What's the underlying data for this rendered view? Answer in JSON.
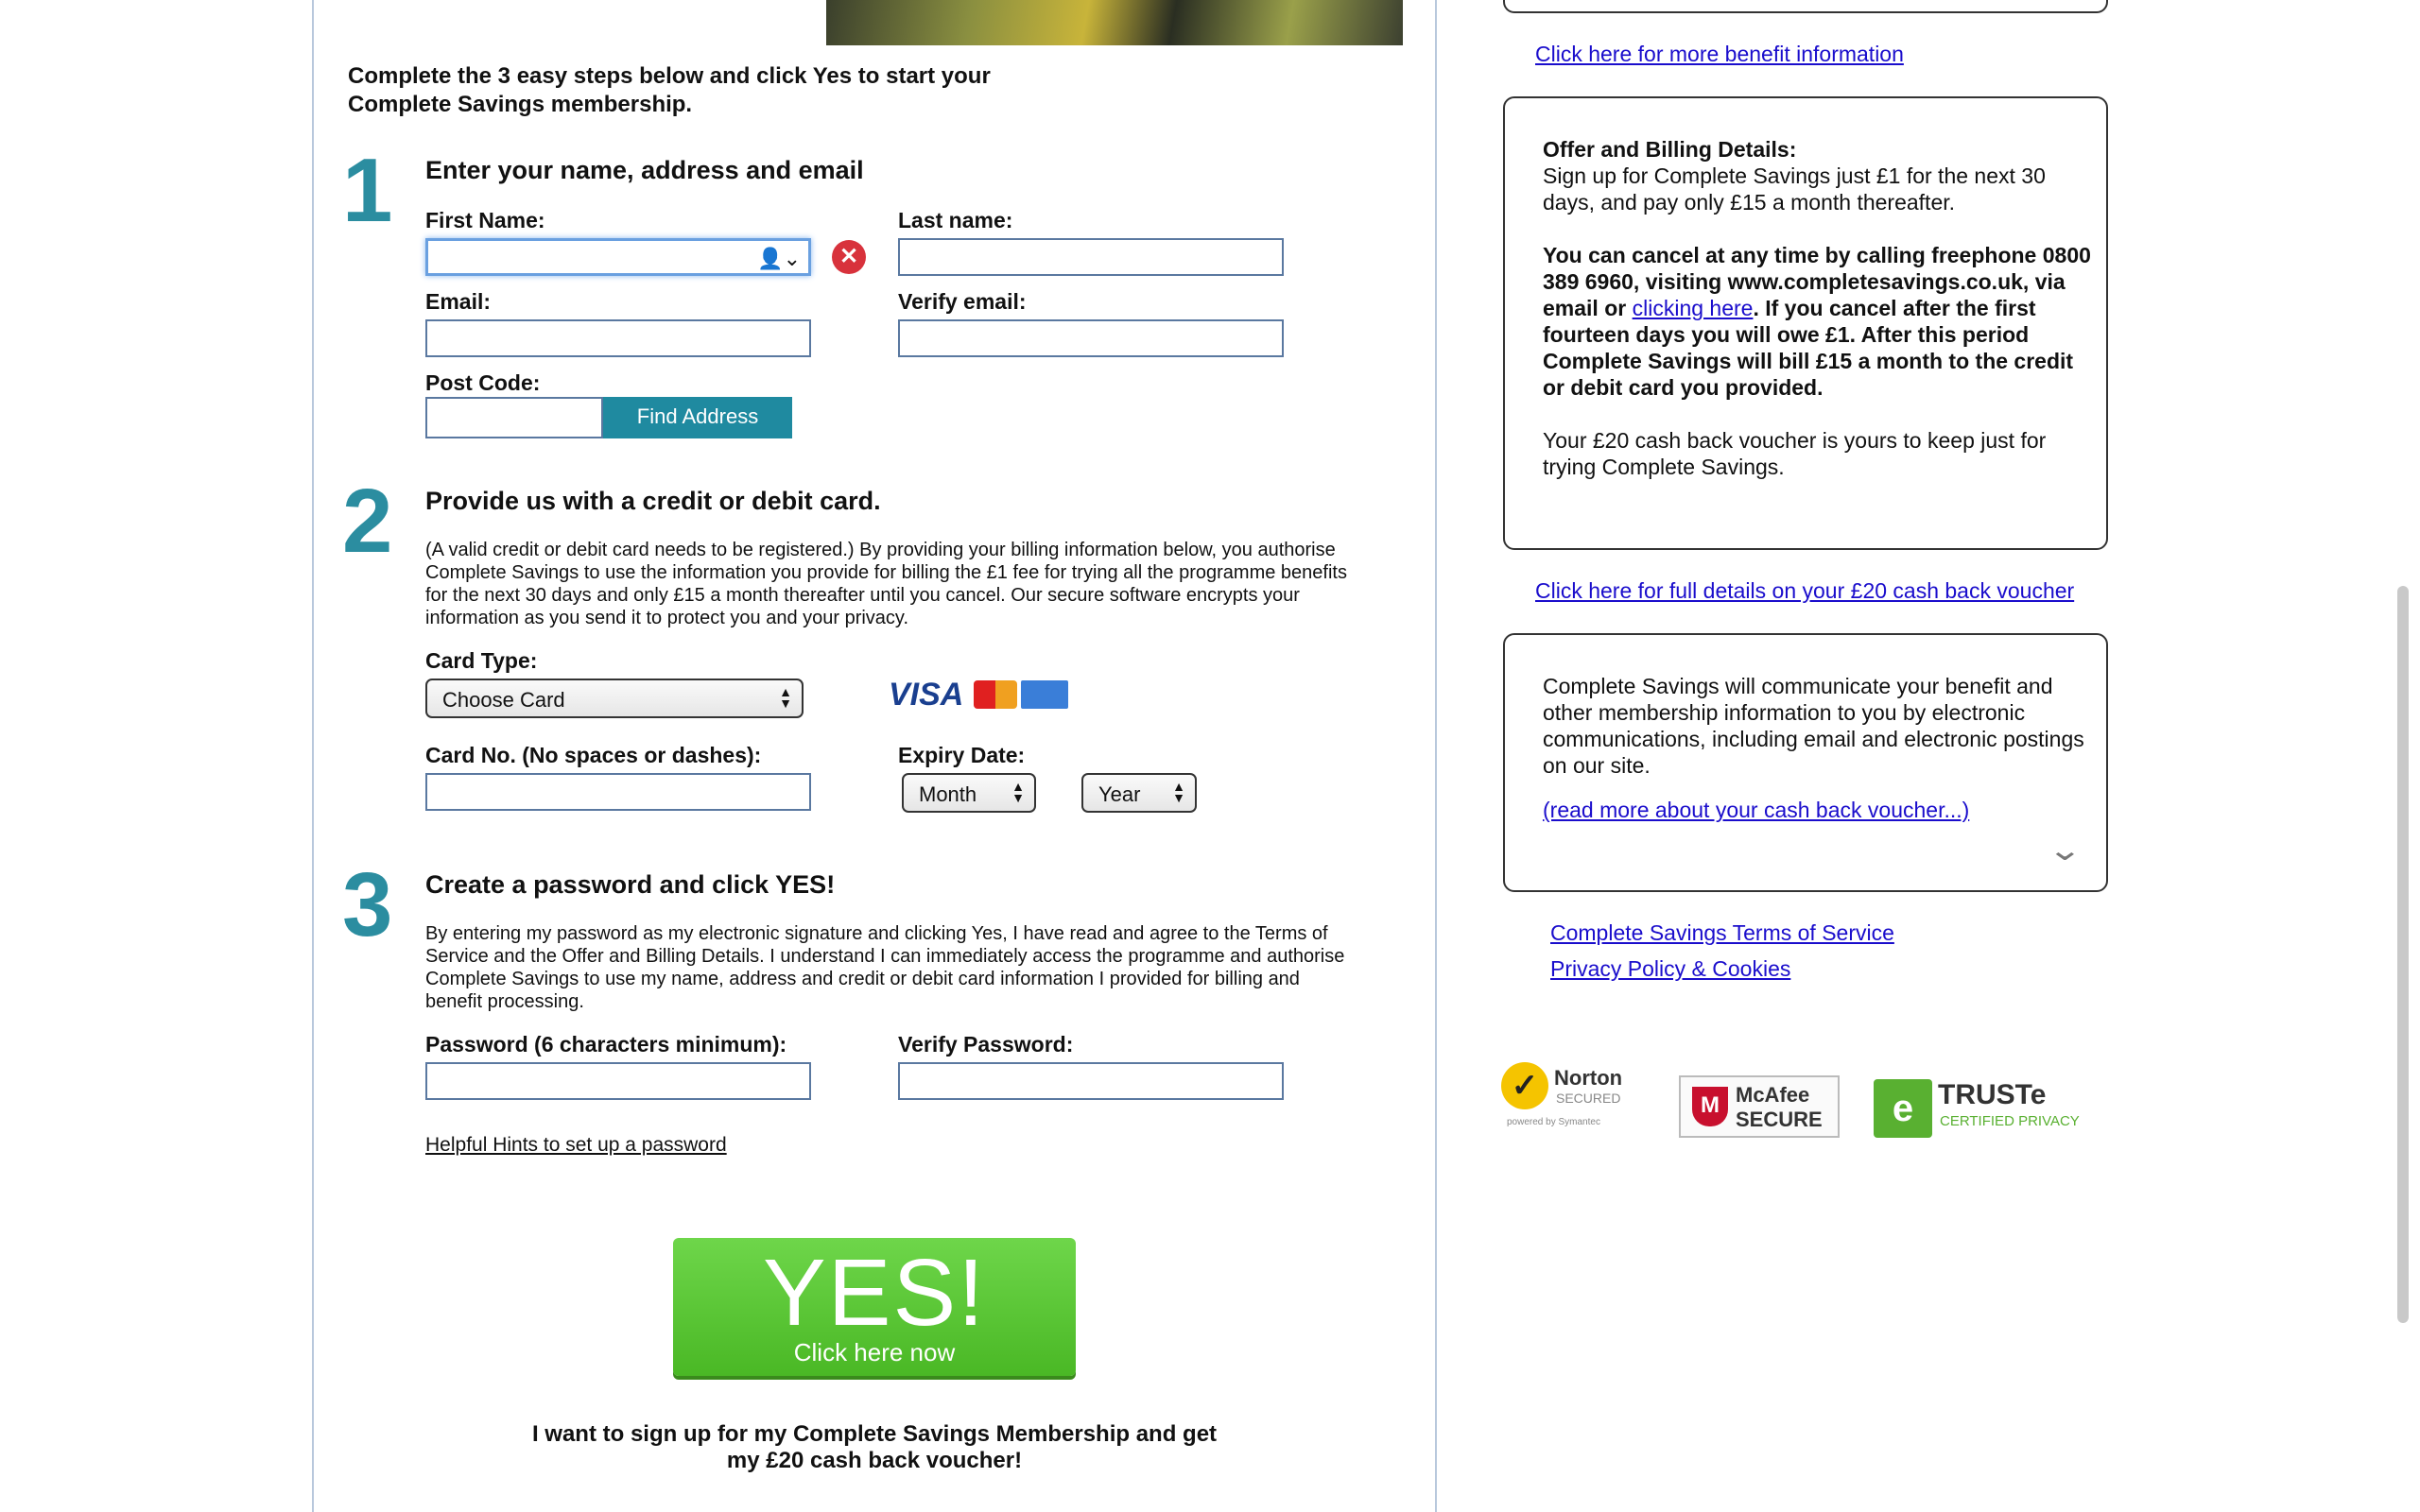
{
  "intro": "Complete the 3 easy steps below and click Yes to start your Complete Savings membership.",
  "step1": {
    "num": "1",
    "heading": "Enter your name, address and email",
    "first_name_label": "First Name:",
    "last_name_label": "Last name:",
    "email_label": "Email:",
    "verify_email_label": "Verify email:",
    "postcode_label": "Post Code:",
    "find_address": "Find Address"
  },
  "step2": {
    "num": "2",
    "heading": "Provide us with a credit or debit card.",
    "text": "(A valid credit or debit card needs to be registered.) By providing your billing information below, you authorise Complete Savings to use the information you provide for billing the £1 fee for trying all the programme benefits for the next 30 days and only £15 a month thereafter until you cancel. Our secure software encrypts your information as you send it to protect you and your privacy.",
    "card_type_label": "Card Type:",
    "card_type_value": "Choose Card",
    "card_no_label": "Card No. (No spaces or dashes):",
    "expiry_label": "Expiry Date:",
    "month_value": "Month",
    "year_value": "Year",
    "visa": "VISA"
  },
  "step3": {
    "num": "3",
    "heading": "Create a password and click YES!",
    "text": "By entering my password as my electronic signature and clicking Yes, I have read and agree to the Terms of Service and the Offer and Billing Details. I understand I can immediately access the programme and authorise Complete Savings to use my name, address and credit or debit card information I provided for billing and benefit processing.",
    "password_label": "Password (6 characters minimum):",
    "verify_password_label": "Verify Password:",
    "hints_link": "Helpful Hints to set up a password"
  },
  "yes_button": {
    "big": "YES!",
    "small": "Click here now"
  },
  "final_text": "I want to sign up for my Complete Savings Membership and get my £20 cash back voucher!",
  "right": {
    "benefit_link": "Click here for more benefit information",
    "offer_title": "Offer and Billing Details:",
    "offer_text": "Sign up for Complete Savings just £1 for the next 30 days, and pay only £15 a month thereafter.",
    "cancel_part1": "You can cancel at any time by calling freephone 0800 389 6960, visiting www.completesavings.co.uk, via email or ",
    "cancel_link": "clicking here",
    "cancel_part2": ". If you cancel after the first fourteen days you will owe £1. After this period Complete Savings will bill £15 a month to the credit or debit card you provided.",
    "voucher_text": "Your £20 cash back voucher is yours to keep just for trying Complete Savings.",
    "voucher_link": "Click here for full details on your £20 cash back voucher",
    "comm_text": "Complete Savings will communicate your benefit and other membership information to you by electronic communications, including email and electronic postings on our site.",
    "read_more_link": "(read more about your cash back voucher...)",
    "terms_link": "Complete Savings Terms of Service",
    "privacy_link": "Privacy Policy & Cookies"
  },
  "badges": {
    "norton": "Norton",
    "norton_sub": "SECURED",
    "norton_powered": "powered by Symantec",
    "mcafee": "McAfee",
    "mcafee_sub": "SECURE",
    "truste": "TRUSTe",
    "truste_sub": "CERTIFIED PRIVACY"
  }
}
